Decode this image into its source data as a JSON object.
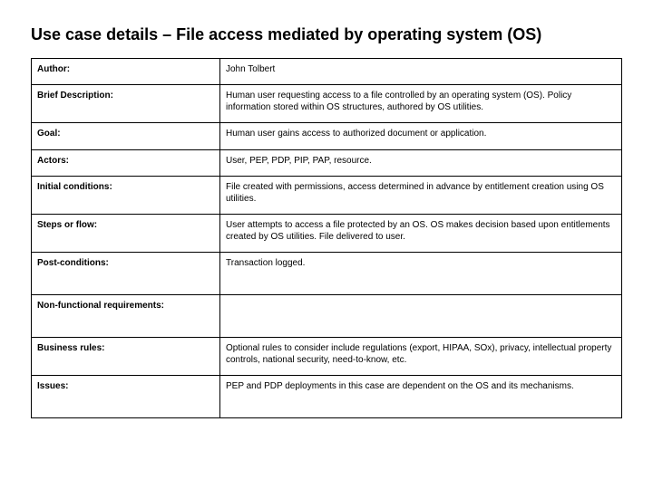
{
  "title": "Use case details – File access mediated by operating system (OS)",
  "rows": [
    {
      "label": "Author:",
      "value": "John Tolbert"
    },
    {
      "label": "Brief Description:",
      "value": "Human user requesting access to a file controlled by an operating system (OS).  Policy information stored within OS structures, authored by OS utilities."
    },
    {
      "label": "Goal:",
      "value": "Human user gains access to authorized document or application."
    },
    {
      "label": "Actors:",
      "value": "User, PEP, PDP, PIP, PAP, resource."
    },
    {
      "label": "Initial conditions:",
      "value": "File created with permissions, access determined in advance by entitlement creation using OS utilities."
    },
    {
      "label": "Steps or flow:",
      "value": "User attempts to access a file protected by an OS.  OS makes decision based upon entitlements created by OS utilities.  File delivered to user."
    },
    {
      "label": "Post-conditions:",
      "value": "Transaction logged."
    },
    {
      "label": "Non-functional requirements:",
      "value": ""
    },
    {
      "label": "Business rules:",
      "value": "Optional rules to consider include regulations (export, HIPAA, SOx), privacy, intellectual property controls, national security, need-to-know, etc."
    },
    {
      "label": "Issues:",
      "value": "PEP and PDP deployments in this case are dependent on the OS and its mechanisms."
    }
  ]
}
